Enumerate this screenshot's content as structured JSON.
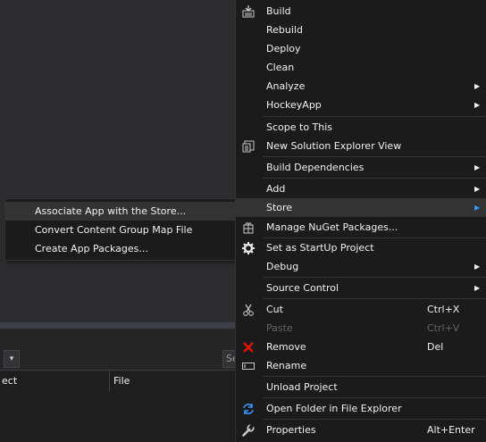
{
  "background": {
    "dropdown_arrow": "▾",
    "search_text": "Se",
    "grid_columns": [
      "ect",
      "File"
    ]
  },
  "submenu": {
    "items": [
      {
        "label": "Associate App with the Store...",
        "highlighted": true
      },
      {
        "label": "Convert Content Group Map File",
        "highlighted": false
      },
      {
        "label": "Create App Packages...",
        "highlighted": false
      }
    ]
  },
  "context_menu": {
    "items": [
      {
        "label": "Build",
        "icon": "build-icon"
      },
      {
        "label": "Rebuild"
      },
      {
        "label": "Deploy"
      },
      {
        "label": "Clean"
      },
      {
        "label": "Analyze",
        "submenu": true
      },
      {
        "label": "HockeyApp",
        "submenu": true
      },
      {
        "label": "Scope to This"
      },
      {
        "label": "New Solution Explorer View",
        "icon": "new-view-icon"
      },
      {
        "label": "Build Dependencies",
        "submenu": true
      },
      {
        "label": "Add",
        "submenu": true
      },
      {
        "label": "Store",
        "submenu": true,
        "highlighted": true
      },
      {
        "label": "Manage NuGet Packages...",
        "icon": "nuget-icon"
      },
      {
        "label": "Set as StartUp Project",
        "icon": "gear-icon"
      },
      {
        "label": "Debug",
        "submenu": true
      },
      {
        "label": "Source Control",
        "submenu": true
      },
      {
        "label": "Cut",
        "shortcut": "Ctrl+X",
        "icon": "cut-icon"
      },
      {
        "label": "Paste",
        "shortcut": "Ctrl+V",
        "disabled": true
      },
      {
        "label": "Remove",
        "shortcut": "Del",
        "icon": "remove-icon"
      },
      {
        "label": "Rename",
        "icon": "rename-icon"
      },
      {
        "label": "Unload Project"
      },
      {
        "label": "Open Folder in File Explorer",
        "icon": "refresh-icon"
      },
      {
        "label": "Properties",
        "shortcut": "Alt+Enter",
        "icon": "wrench-icon"
      }
    ],
    "submenu_arrow": "▶"
  },
  "colors": {
    "menu_bg": "#1b1b1c",
    "highlight_bg": "#333334",
    "text": "#f1f1f1",
    "disabled_text": "#656565",
    "accent_blue": "#3399ff",
    "remove_red": "#e51400"
  }
}
